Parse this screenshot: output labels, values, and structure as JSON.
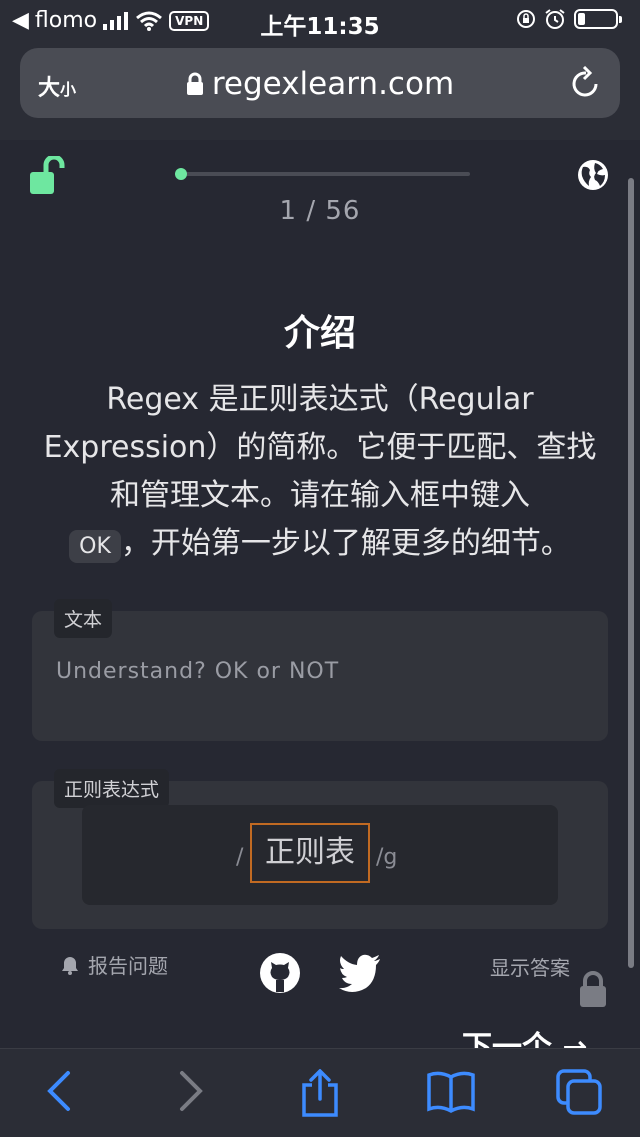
{
  "status_bar": {
    "back_app": "flomo",
    "vpn": "VPN",
    "time": "上午11:35",
    "battery_level": 0.2
  },
  "browser": {
    "text_size_big": "大",
    "text_size_small": "小",
    "url": "regexlearn.com"
  },
  "lesson": {
    "progress": "1 / 56",
    "progress_fraction": 0.018,
    "title": "介绍",
    "desc_part1": "Regex 是正则表达式（Regular Expression）的简称。它便于匹配、查找和管理文本。请在输入框中键入",
    "desc_code": "OK",
    "desc_part2": "，开始第一步以了解更多的细节。"
  },
  "text_panel": {
    "label": "文本",
    "content": "Understand? OK or NOT"
  },
  "regex_panel": {
    "label": "正则表达式",
    "open_slash": "/",
    "value": "正则表",
    "flags": "/g"
  },
  "footer": {
    "report": "报告问题",
    "show_answer": "显示答案",
    "next": "下一个 →"
  },
  "colors": {
    "accent_green": "#6ee7a0",
    "input_border": "#c16a22",
    "background": "#262832"
  },
  "icons": {
    "unlock": "unlock-icon",
    "globe": "globe-icon",
    "github": "github-icon",
    "twitter": "twitter-icon",
    "bell": "bell-icon",
    "lock": "lock-icon"
  }
}
